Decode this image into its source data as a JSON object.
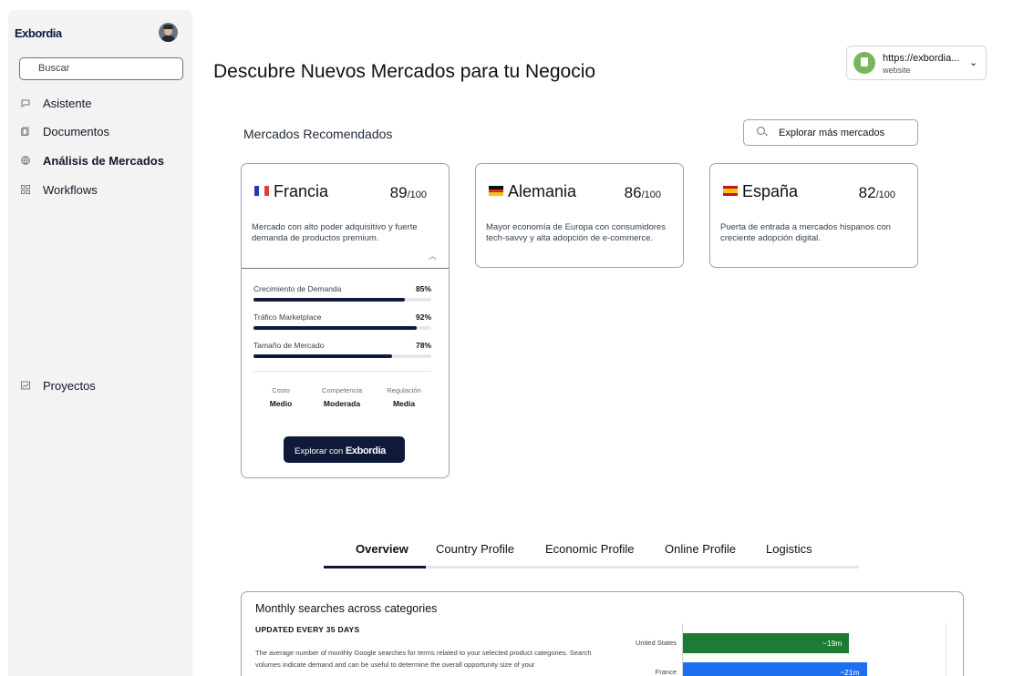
{
  "sidebar": {
    "logo": "Exbordia",
    "search_placeholder": "Buscar",
    "items": [
      {
        "label": "Asistente",
        "icon": "chat-icon"
      },
      {
        "label": "Documentos",
        "icon": "documents-icon"
      },
      {
        "label": "Análisis de Mercados",
        "icon": "globe-icon",
        "active": true
      },
      {
        "label": "Workflows",
        "icon": "workflow-icon"
      },
      {
        "label": "Proyectos",
        "icon": "chart-icon"
      }
    ]
  },
  "header": {
    "title": "Descubre Nuevos Mercados para tu Negocio",
    "site_url": "https://exbordia...",
    "site_kind": "website"
  },
  "recommended": {
    "title": "Mercados Recomendados",
    "explore_label": "Explorar más mercados",
    "cards": [
      {
        "name": "Francia",
        "score": "89",
        "out_of": "/100",
        "desc": "Mercado con alto poder adquisitivo y fuerte demanda de productos premium.",
        "metrics": [
          {
            "label": "Crecimiento de Demanda",
            "value": "85%",
            "fraction": 0.85
          },
          {
            "label": "Tráfico Marketplace",
            "value": "92%",
            "fraction": 0.92
          },
          {
            "label": "Tamaño de Mercado",
            "value": "78%",
            "fraction": 0.78
          }
        ],
        "attributes": [
          {
            "label": "Costo",
            "value": "Medio"
          },
          {
            "label": "Competencia",
            "value": "Moderada"
          },
          {
            "label": "Regulación",
            "value": "Media"
          }
        ],
        "cta_prefix": "Explorar con",
        "cta_brand": "Exbordia"
      },
      {
        "name": "Alemania",
        "score": "86",
        "out_of": "/100",
        "desc": "Mayor economía de Europa con consumidores tech-savvy y alta adopción de e-commerce."
      },
      {
        "name": "España",
        "score": "82",
        "out_of": "/100",
        "desc": "Puerta de entrada a mercados hispanos con creciente adopción digital."
      }
    ]
  },
  "tabs": [
    "Overview",
    "Country Profile",
    "Economic Profile",
    "Online Profile",
    "Logistics"
  ],
  "panel": {
    "title": "Monthly searches across categories",
    "updated": "UPDATED EVERY 35 DAYS",
    "desc": "The average number of monthly Google searches for terms related to your selected product categories. Search volumes indicate demand and can be useful to determine the overall opportunity size of your",
    "colors": {
      "us": "#1e7b34",
      "fr": "#1d6ff2"
    }
  },
  "chart_data": {
    "type": "bar",
    "categories": [
      "United States",
      "France"
    ],
    "values": [
      19,
      21
    ],
    "data_labels": [
      "~19m",
      "~21m"
    ]
  }
}
